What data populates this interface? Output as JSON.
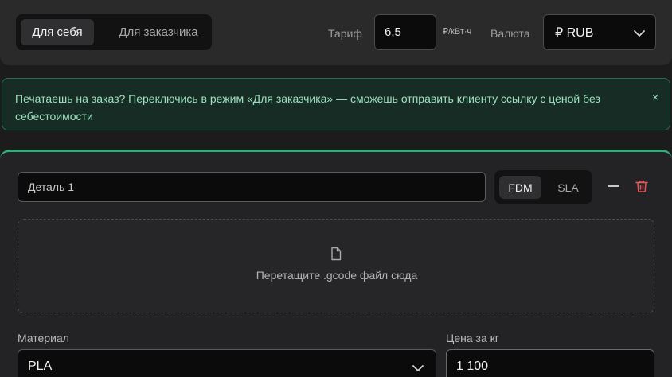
{
  "settings": {
    "mode_tabs": [
      {
        "label": "Для себя",
        "active": true
      },
      {
        "label": "Для заказчика",
        "active": false
      }
    ],
    "tariff_label": "Тариф",
    "tariff_value": "6,5",
    "tariff_unit": "₽/кВт·ч",
    "currency_label": "Валюта",
    "currency_value": "₽ RUB"
  },
  "banner": {
    "text": "Печатаешь на заказ? Переключись в режим «Для заказчика» — сможешь отправить клиенту ссылку с ценой без себестоимости",
    "close": "×"
  },
  "part": {
    "name_value": "Деталь 1",
    "tech_tabs": [
      {
        "label": "FDM",
        "active": true
      },
      {
        "label": "SLA",
        "active": false
      }
    ],
    "dropzone_text": "Перетащите .gcode файл сюда",
    "material_label": "Материал",
    "material_value": "PLA",
    "price_label": "Цена за кг",
    "price_value": "1 100"
  },
  "colors": {
    "accent": "#2fae79",
    "banner_bg": "#162c24",
    "banner_text": "#9ce2bf",
    "danger": "#e0585b"
  },
  "icons": [
    "chevron-down-icon",
    "close-icon",
    "minus-icon",
    "trash-icon",
    "file-icon"
  ]
}
